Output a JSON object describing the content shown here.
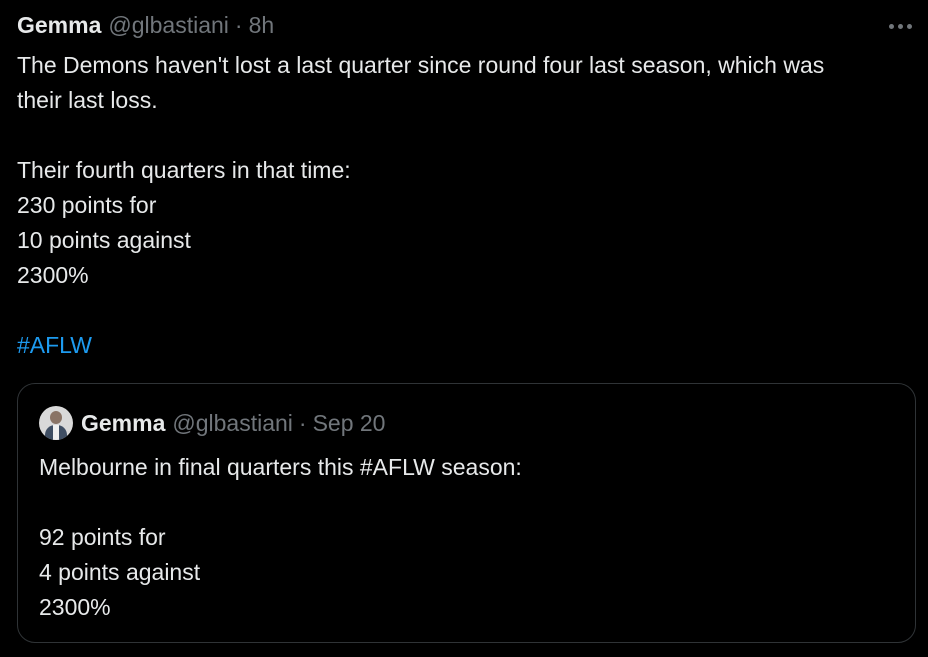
{
  "tweet": {
    "author_name": "Gemma",
    "author_handle": "@glbastiani",
    "separator": "·",
    "time": "8h",
    "more_icon": "more-horizontal-icon",
    "lines": [
      "The Demons haven't lost a last quarter since round four last season, which was",
      "their last loss.",
      "",
      "Their fourth quarters in that time:",
      "230 points for",
      "10 points against",
      "2300%",
      ""
    ],
    "hashtag": "#AFLW"
  },
  "quote": {
    "author_name": "Gemma",
    "author_handle": "@glbastiani",
    "separator": "·",
    "date": "Sep 20",
    "lines": [
      "Melbourne in final quarters this #AFLW season:",
      "",
      "92 points for",
      "4 points against",
      "2300%"
    ]
  },
  "colors": {
    "background": "#000000",
    "text": "#e7e9ea",
    "secondary_text": "#71767b",
    "link": "#1d9bf0",
    "border": "#2f3336"
  }
}
